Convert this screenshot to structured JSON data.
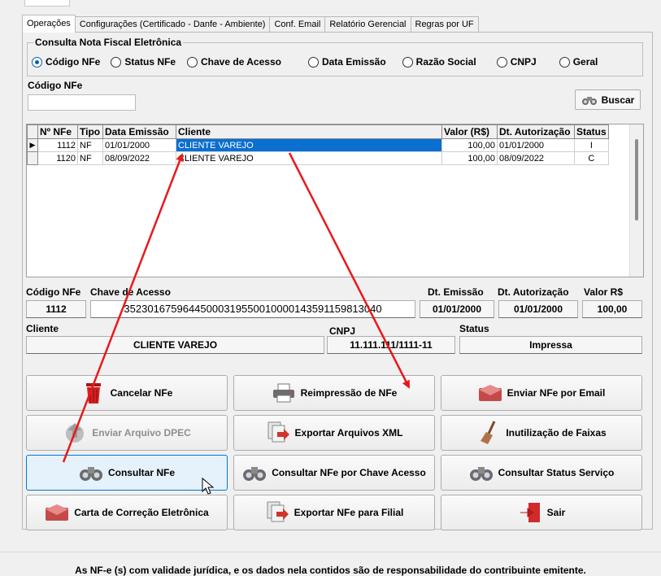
{
  "tabs": [
    {
      "label": "Operações"
    },
    {
      "label": "Configurações (Certificado - Danfe - Ambiente)"
    },
    {
      "label": "Conf. Email"
    },
    {
      "label": "Relatório Gerencial"
    },
    {
      "label": "Regras por UF"
    }
  ],
  "query": {
    "group_title": "Consulta Nota Fiscal Eletrônica",
    "options": [
      {
        "label": "Código NFe",
        "checked": true
      },
      {
        "label": "Status NFe",
        "checked": false
      },
      {
        "label": "Chave de Acesso",
        "checked": false
      },
      {
        "label": "Data Emissão",
        "checked": false
      },
      {
        "label": "Razão Social",
        "checked": false
      },
      {
        "label": "CNPJ",
        "checked": false
      },
      {
        "label": "Geral",
        "checked": false
      }
    ],
    "field_label": "Código NFe",
    "field_value": "",
    "search_button": "Buscar"
  },
  "grid": {
    "columns": [
      "Nº NFe",
      "Tipo",
      "Data Emissão",
      "Cliente",
      "Valor (R$)",
      "Dt. Autorização",
      "Status"
    ],
    "rows": [
      {
        "nfe": "1112",
        "tipo": "NF",
        "emissao": "01/01/2000",
        "cliente": "CLIENTE VAREJO",
        "valor": "100,00",
        "autorizacao": "01/01/2000",
        "status": "I",
        "selected": true
      },
      {
        "nfe": "1120",
        "tipo": "NF",
        "emissao": "08/09/2022",
        "cliente": "CLIENTE VAREJO",
        "valor": "100,00",
        "autorizacao": "08/09/2022",
        "status": "C",
        "selected": false
      }
    ]
  },
  "detail": {
    "labels": {
      "codigo": "Código NFe",
      "chave": "Chave de Acesso",
      "emissao": "Dt. Emissão",
      "autorizacao": "Dt. Autorização",
      "valor": "Valor R$",
      "cliente": "Cliente",
      "cnpj": "CNPJ",
      "status": "Status"
    },
    "codigo": "1112",
    "chave": "35230167596445000319550010000143591159813040",
    "emissao": "01/01/2000",
    "autorizacao": "01/01/2000",
    "valor": "100,00",
    "cliente": "CLIENTE VAREJO",
    "cnpj": "11.111.111/1111-11",
    "status": "Impressa"
  },
  "actions": {
    "cancelar": "Cancelar NFe",
    "reimpressao": "Reimpressão de NFe",
    "enviar_email": "Enviar NFe por Email",
    "dpec": "Enviar Arquivo DPEC",
    "exportar_xml": "Exportar Arquivos XML",
    "inutilizacao": "Inutilização de Faixas",
    "consultar": "Consultar NFe",
    "consultar_chave": "Consultar NFe por Chave Acesso",
    "consultar_status": "Consultar Status Serviço",
    "carta_correcao": "Carta de Correção Eletrônica",
    "exportar_filial": "Exportar NFe para Filial",
    "sair": "Sair"
  },
  "footer": "As NF-e (s) com validade jurídica, e os dados nela contidos são de responsabilidade do contribuinte emitente.",
  "colors": {
    "accent": "#0a6fd0",
    "annotation": "#e8191c",
    "hover_bg": "#e5f1fb"
  }
}
